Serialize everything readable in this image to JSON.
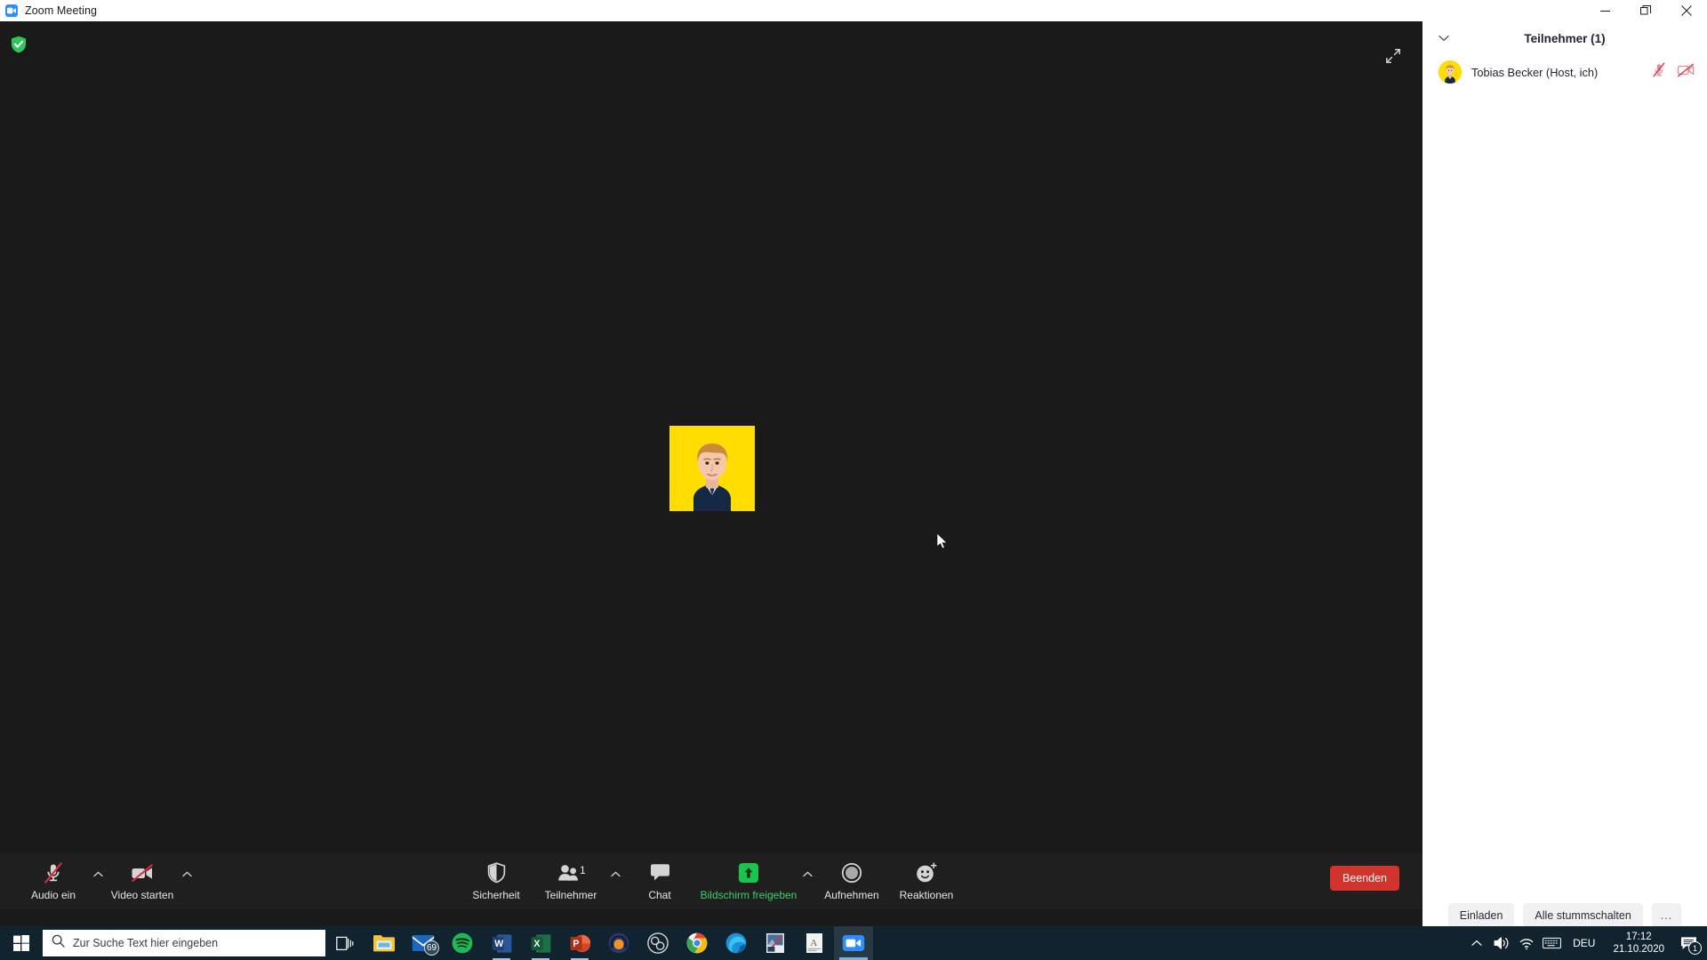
{
  "window": {
    "title": "Zoom Meeting",
    "app_icon": "zoom-video-icon",
    "minimize_label": "—",
    "restore_label": "❐",
    "close_label": "✕"
  },
  "stage": {
    "encryption_icon": "green-shield-check-icon",
    "fullscreen_icon": "expand-diagonal-icon",
    "self_view_name": "Tobias Becker",
    "self_view_mic_icon": "muted-microphone-icon",
    "avatar_icon": "user-photo-avatar",
    "avatar_bg": "#FFDD00",
    "cursor_icon": "mouse-pointer"
  },
  "toolbar": {
    "audio": {
      "label": "Audio ein",
      "icon": "microphone-muted-icon",
      "caret": "chevron-up-icon"
    },
    "video": {
      "label": "Video starten",
      "icon": "camera-muted-icon",
      "caret": "chevron-up-icon"
    },
    "security": {
      "label": "Sicherheit",
      "icon": "shield-icon"
    },
    "participants": {
      "label": "Teilnehmer",
      "icon": "people-icon",
      "count": "1",
      "caret": "chevron-up-icon"
    },
    "chat": {
      "label": "Chat",
      "icon": "speech-bubble-icon"
    },
    "share": {
      "label": "Bildschirm freigeben",
      "icon": "share-screen-arrow-icon",
      "caret": "chevron-up-icon",
      "accent": "#19C64C"
    },
    "record": {
      "label": "Aufnehmen",
      "icon": "record-circle-icon"
    },
    "reactions": {
      "label": "Reaktionen",
      "icon": "smiley-reaction-icon"
    },
    "end": {
      "label": "Beenden",
      "color": "#D0342C"
    }
  },
  "panel": {
    "collapse_icon": "chevron-down-icon",
    "title": "Teilnehmer (1)",
    "participants": [
      {
        "name": "Tobias Becker (Host, ich)",
        "avatar_icon": "user-photo-avatar",
        "mic_icon": "muted-microphone-icon",
        "video_icon": "muted-video-icon"
      }
    ],
    "footer": {
      "invite_label": "Einladen",
      "mute_all_label": "Alle stummschalten",
      "more_label": "..."
    }
  },
  "taskbar": {
    "start_icon": "windows-start-icon",
    "search_icon": "search-icon",
    "search_placeholder": "Zur Suche Text hier eingeben",
    "taskview_icon": "task-view-icon",
    "apps": [
      {
        "name": "file-explorer",
        "icon": "folder-icon",
        "badge": ""
      },
      {
        "name": "mail",
        "icon": "mail-icon",
        "badge": "69"
      },
      {
        "name": "spotify",
        "icon": "spotify-icon",
        "badge": ""
      },
      {
        "name": "word",
        "icon": "word-icon",
        "badge": ""
      },
      {
        "name": "excel",
        "icon": "excel-icon",
        "badge": ""
      },
      {
        "name": "powerpoint",
        "icon": "powerpoint-icon",
        "badge": ""
      },
      {
        "name": "audio-app",
        "icon": "headphones-icon",
        "badge": ""
      },
      {
        "name": "obs-studio",
        "icon": "obs-icon",
        "badge": ""
      },
      {
        "name": "chrome",
        "icon": "chrome-icon",
        "badge": ""
      },
      {
        "name": "edge",
        "icon": "edge-icon",
        "badge": ""
      },
      {
        "name": "photo-editor",
        "icon": "image-icon",
        "badge": ""
      },
      {
        "name": "document-viewer",
        "icon": "document-icon",
        "badge": ""
      },
      {
        "name": "zoom",
        "icon": "zoom-video-icon",
        "badge": ""
      }
    ],
    "tray": {
      "overflow_icon": "chevron-up-icon",
      "volume_icon": "speaker-icon",
      "network_icon": "wifi-icon",
      "keyboard_icon": "keyboard-icon",
      "language": "DEU",
      "time": "17:12",
      "date": "21.10.2020",
      "notification_icon": "notification-icon",
      "notification_count": "1"
    }
  }
}
